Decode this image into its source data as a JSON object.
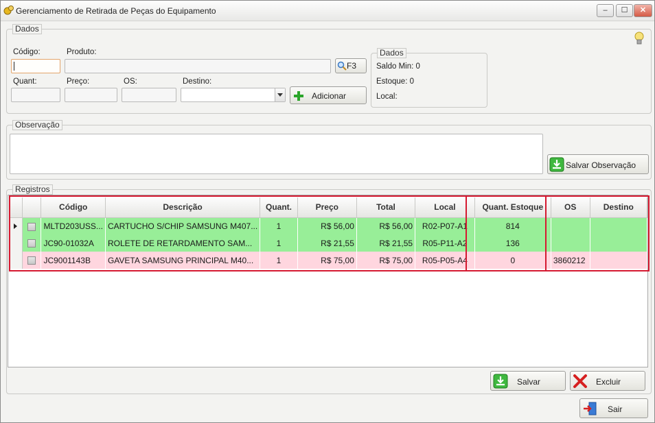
{
  "window": {
    "title": "Gerenciamento de Retirada de Peças do Equipamento",
    "minimize": "–",
    "maximize": "☐",
    "close": "✕"
  },
  "dados": {
    "legend": "Dados",
    "codigo_label": "Código:",
    "codigo_value": "",
    "produto_label": "Produto:",
    "produto_value": "",
    "f3_label": "F3",
    "quant_label": "Quant:",
    "preco_label": "Preço:",
    "os_label": "OS:",
    "destino_label": "Destino:",
    "adicionar_label": "Adicionar",
    "info": {
      "legend": "Dados",
      "saldo_min": "Saldo Min: 0",
      "estoque": "Estoque: 0",
      "local": "Local:"
    }
  },
  "observacao": {
    "legend": "Observação",
    "value": "",
    "save_label": "Salvar Observação"
  },
  "registros": {
    "legend": "Registros",
    "columns": [
      "Código",
      "Descrição",
      "Quant.",
      "Preço",
      "Total",
      "Local",
      "Quant. Estoque",
      "OS",
      "Destino"
    ],
    "rows": [
      {
        "codigo": "MLTD203USS...",
        "descricao": "CARTUCHO S/CHIP SAMSUNG M407...",
        "quant": "1",
        "preco": "R$ 56,00",
        "total": "R$ 56,00",
        "local": "R02-P07-A1",
        "estoque": "814",
        "os": "",
        "destino": ""
      },
      {
        "codigo": "JC90-01032A",
        "descricao": "ROLETE DE RETARDAMENTO SAM...",
        "quant": "1",
        "preco": "R$ 21,55",
        "total": "R$ 21,55",
        "local": "R05-P11-A2",
        "estoque": "136",
        "os": "",
        "destino": ""
      },
      {
        "codigo": "JC9001143B",
        "descricao": "GAVETA SAMSUNG PRINCIPAL M40...",
        "quant": "1",
        "preco": "R$ 75,00",
        "total": "R$ 75,00",
        "local": "R05-P05-A4",
        "estoque": "0",
        "os": "3860212",
        "destino": ""
      }
    ]
  },
  "actions": {
    "salvar": "Salvar",
    "excluir": "Excluir",
    "sair": "Sair"
  },
  "colors": {
    "row_ok": "#98ee98",
    "row_alert": "#ffd6df",
    "highlight": "#d5182f"
  }
}
